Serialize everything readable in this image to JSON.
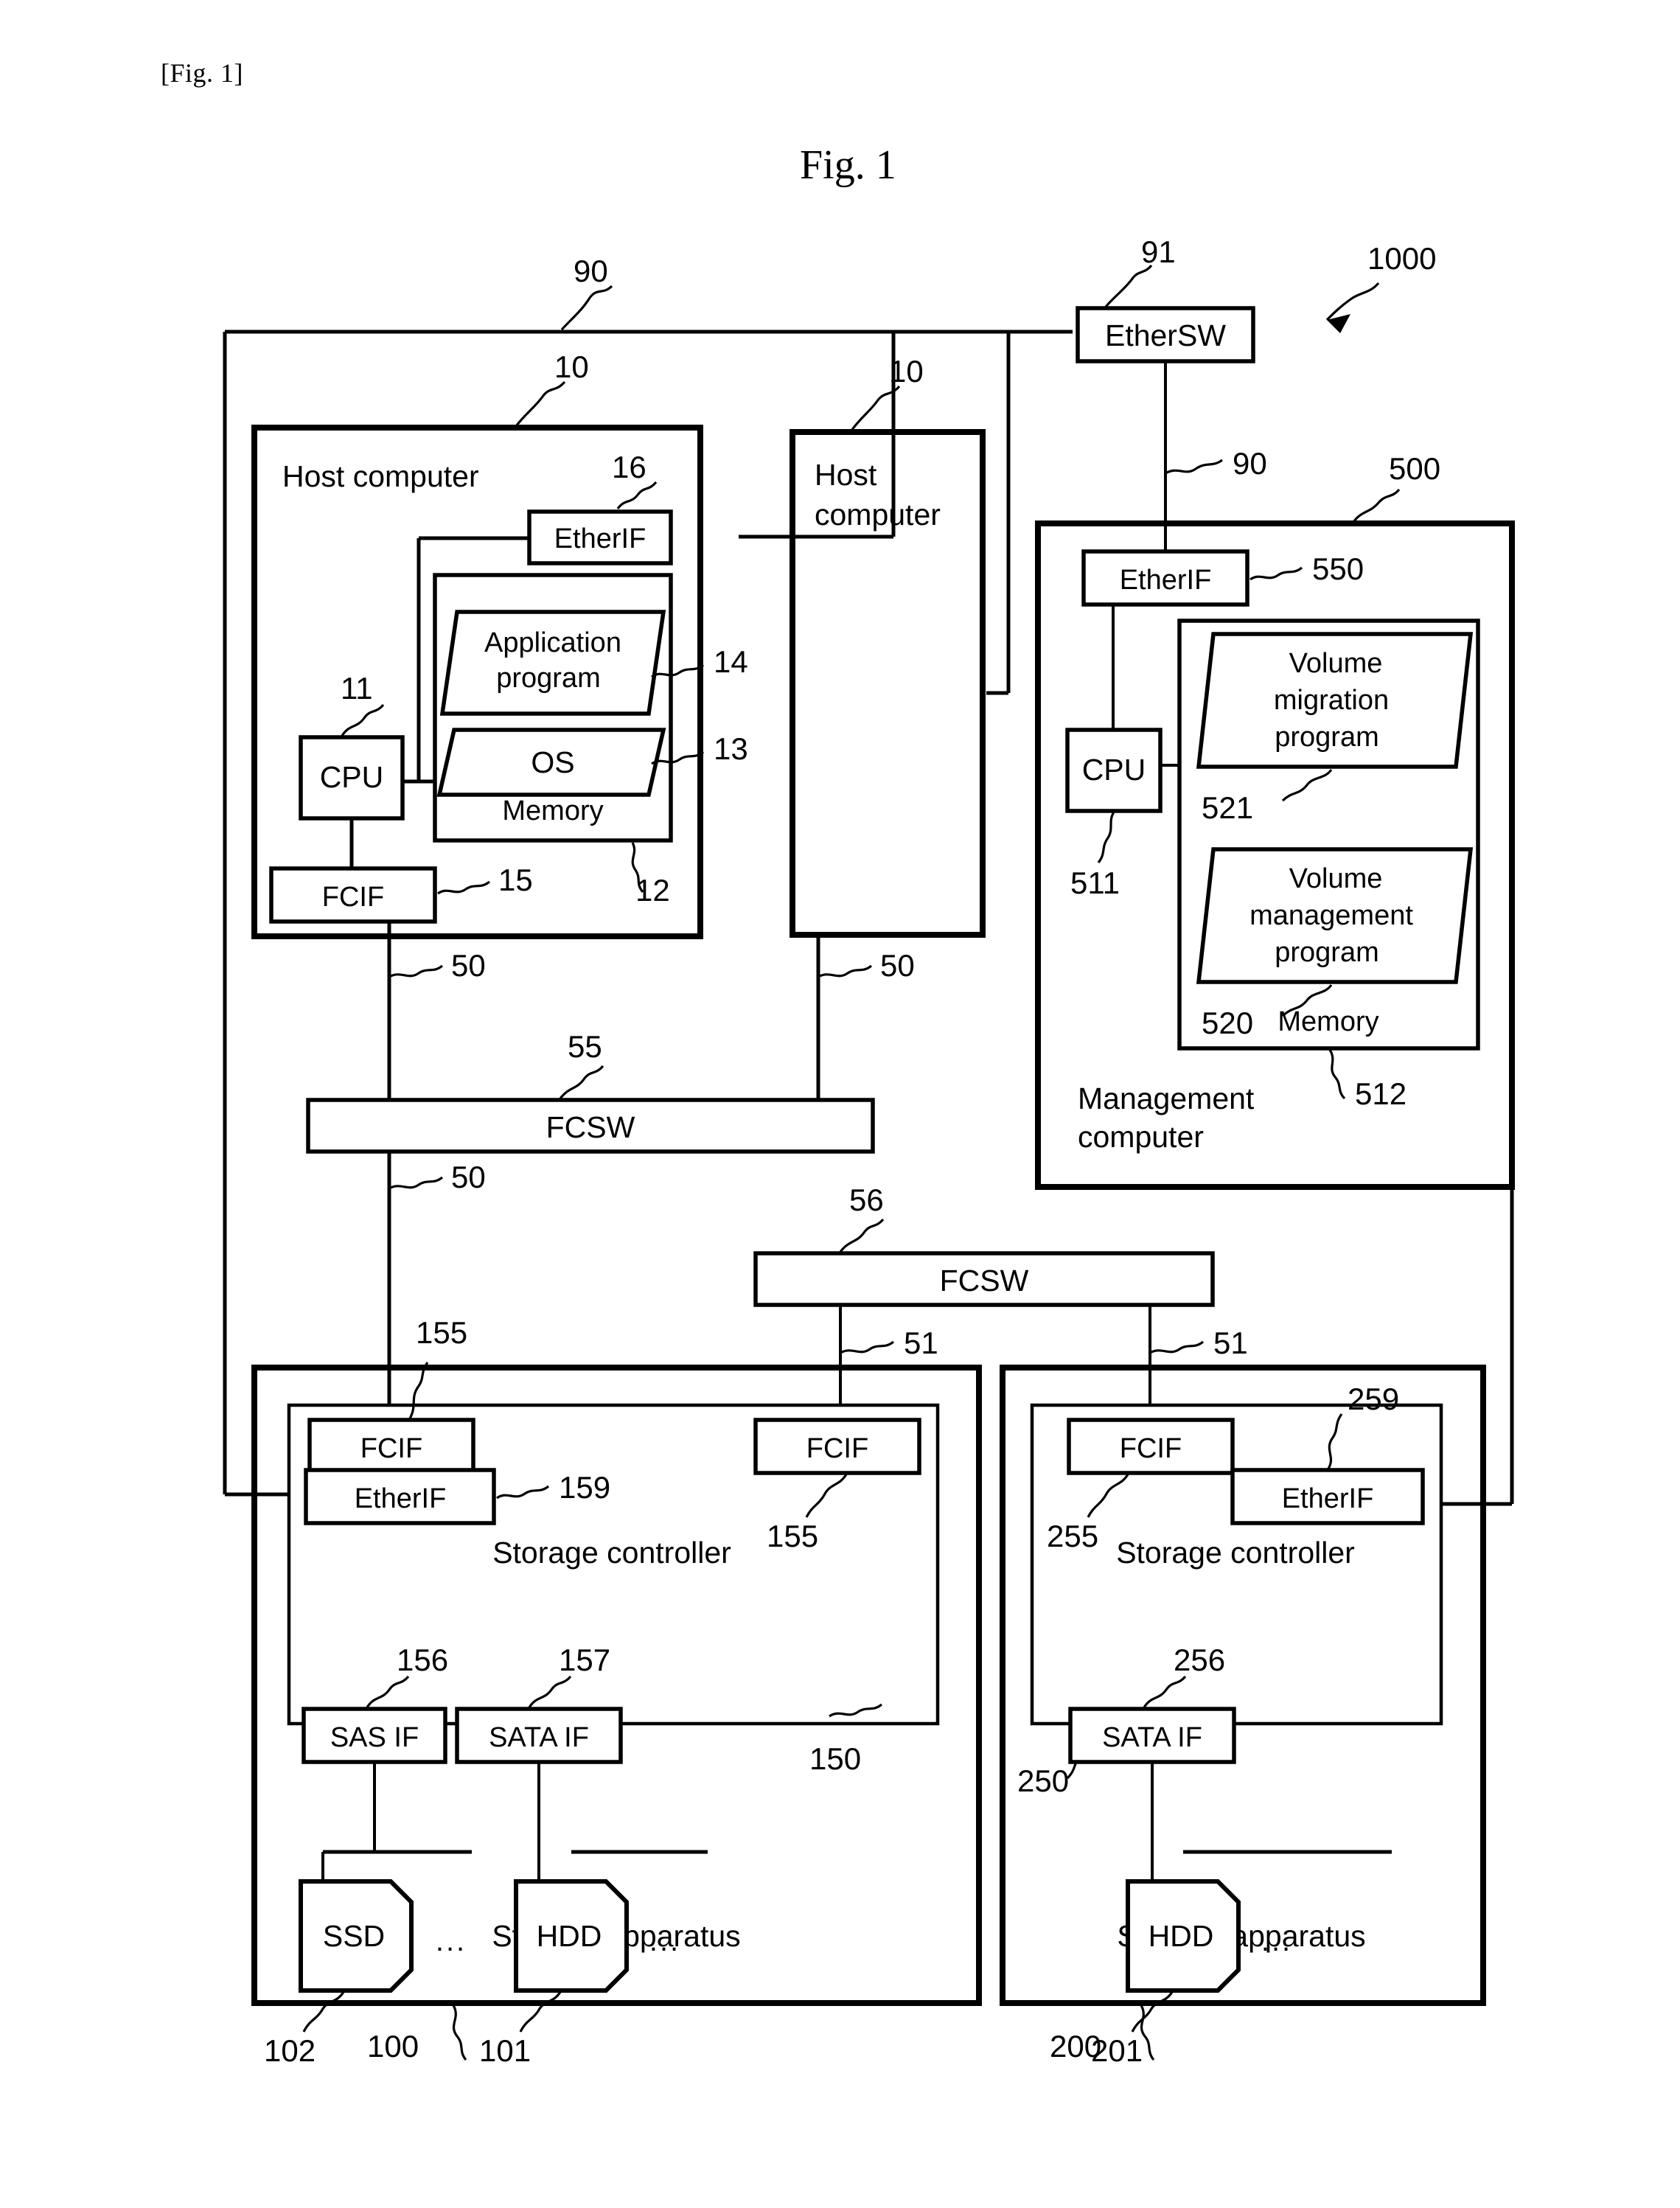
{
  "figure": {
    "tag": "[Fig. 1]",
    "title": "Fig. 1",
    "system_ref": "1000"
  },
  "networks": {
    "ether_sw": {
      "label": "EtherSW",
      "ref": "91"
    },
    "ether_net_ref_top": "90",
    "ether_net_ref_mgmt": "90",
    "fc_sw_upper": {
      "label": "FCSW",
      "ref": "55"
    },
    "fc_sw_lower": {
      "label": "FCSW",
      "ref": "56"
    },
    "fc_link_ref_50": "50",
    "fc_link_ref_51": "51"
  },
  "host_computer_1": {
    "title": "Host computer",
    "ref": "10",
    "etherif": {
      "label": "EtherIF",
      "ref": "16"
    },
    "cpu": {
      "label": "CPU",
      "ref": "11"
    },
    "fcif": {
      "label": "FCIF",
      "ref": "15"
    },
    "memory": {
      "label": "Memory",
      "ref": "12"
    },
    "application_program": {
      "label": "Application program",
      "ref": "14"
    },
    "os": {
      "label": "OS",
      "ref": "13"
    }
  },
  "host_computer_2": {
    "title": "Host computer",
    "ref": "10"
  },
  "management_computer": {
    "title": "Management computer",
    "ref": "500",
    "etherif": {
      "label": "EtherIF",
      "ref": "550"
    },
    "cpu": {
      "label": "CPU",
      "ref": "511"
    },
    "memory": {
      "label": "Memory",
      "ref": "512"
    },
    "volume_migration_program": {
      "label": "Volume migration program",
      "ref": "521"
    },
    "volume_management_program": {
      "label": "Volume management program",
      "ref": "520"
    }
  },
  "storage_apparatus_1": {
    "title": "Storage apparatus",
    "ref": "100",
    "controller": {
      "label": "Storage controller",
      "ref": "150"
    },
    "fcif_left": {
      "label": "FCIF",
      "ref": "155"
    },
    "fcif_right": {
      "label": "FCIF",
      "ref": "155"
    },
    "etherif": {
      "label": "EtherIF",
      "ref": "159"
    },
    "sas_if": {
      "label": "SAS IF",
      "ref": "156"
    },
    "sata_if": {
      "label": "SATA IF",
      "ref": "157"
    },
    "ssd": {
      "label": "SSD",
      "ref": "102"
    },
    "hdd": {
      "label": "HDD",
      "ref": "101"
    },
    "ellipsis": "..."
  },
  "storage_apparatus_2": {
    "title": "Storage apparatus",
    "ref": "200",
    "controller": {
      "label": "Storage controller",
      "ref": "250"
    },
    "fcif": {
      "label": "FCIF",
      "ref": "255"
    },
    "etherif": {
      "label": "EtherIF",
      "ref": "259"
    },
    "sata_if": {
      "label": "SATA IF",
      "ref": "256"
    },
    "hdd": {
      "label": "HDD",
      "ref": "201"
    },
    "ellipsis": "..."
  },
  "colors": {
    "ink": "#000000",
    "paper": "#ffffff"
  }
}
